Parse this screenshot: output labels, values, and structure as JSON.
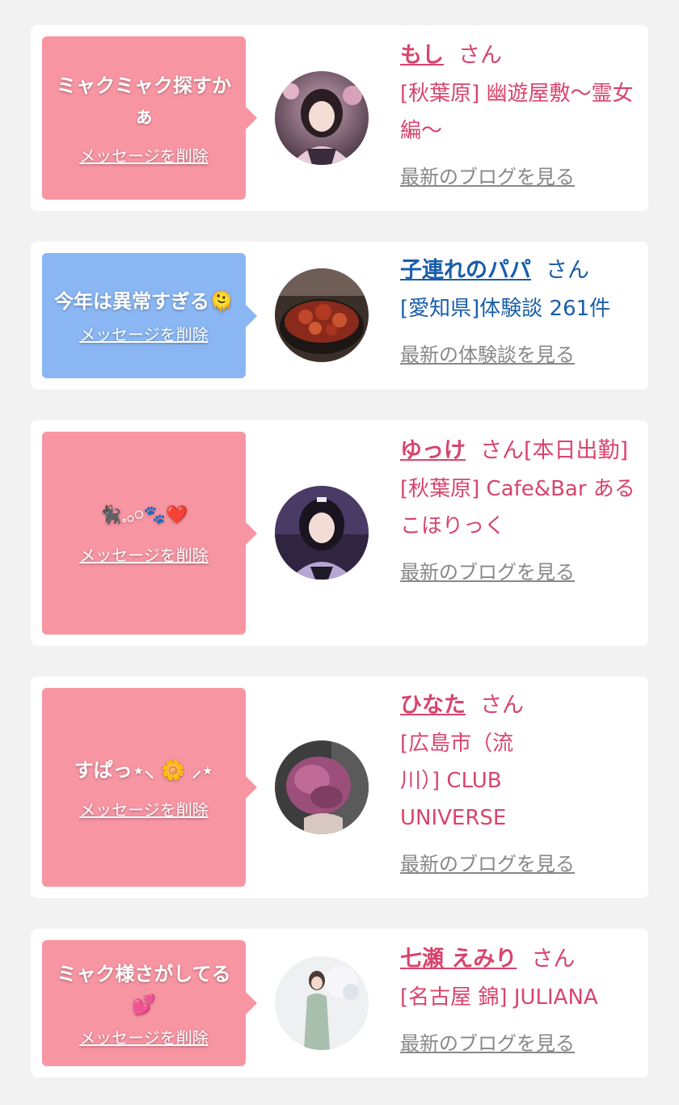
{
  "cards": [
    {
      "message": "ミャクミャク探すかぁ",
      "delete_label": "メッセージを削除",
      "name": "もし",
      "honorific": "さん",
      "shop": "[秋葉原] 幽遊屋敷〜霊女編〜",
      "link": "最新のブログを見る",
      "theme": "pink",
      "avatar": "girl-photo"
    },
    {
      "message": "今年は異常すぎる🫠",
      "delete_label": "メッセージを削除",
      "name": "子連れのパパ",
      "honorific": "さん",
      "shop": "[愛知県]体験談 261件",
      "link": "最新の体験談を見る",
      "theme": "blue",
      "avatar": "food-photo"
    },
    {
      "message": "🐈‍⬛𓈒𓂂𓏸🐾❤️",
      "delete_label": "メッセージを削除",
      "name": "ゆっけ",
      "honorific": "さん[本日出勤]",
      "shop": "[秋葉原] Cafe&Bar あるこほりっく",
      "link": "最新のブログを見る",
      "theme": "pink",
      "avatar": "girl-photo"
    },
    {
      "message": "すぱっ⋆⸜ 🌼 ⸝⋆",
      "delete_label": "メッセージを削除",
      "name": "ひなた",
      "honorific": "さん",
      "shop": "[広島市（流川）] CLUB UNIVERSE",
      "link": "最新のブログを見る",
      "theme": "pink",
      "avatar": "hair-photo"
    },
    {
      "message": "ミャク様さがしてる💕",
      "delete_label": "メッセージを削除",
      "name": "七瀬 えみり",
      "honorific": "さん",
      "shop": "[名古屋 錦] JULIANA",
      "link": "最新のブログを見る",
      "theme": "pink",
      "avatar": "girl-photo-light"
    }
  ]
}
